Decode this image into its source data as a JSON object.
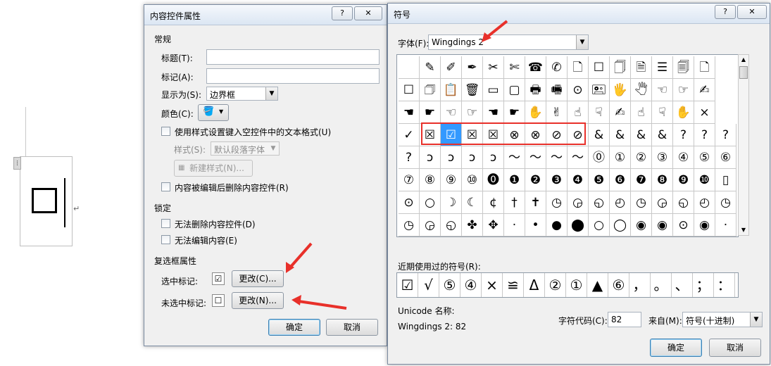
{
  "doc": {
    "return_mark": "↵"
  },
  "content_dialog": {
    "title": "内容控件属性",
    "help_btn": "?",
    "close_btn": "✕",
    "general_section": "常规",
    "title_label": "标题(T):",
    "tag_label": "标记(A):",
    "show_as_label": "显示为(S):",
    "show_as_value": "边界框",
    "color_label": "颜色(C):",
    "use_style_label": "使用样式设置键入空控件中的文本格式(U)",
    "style_label": "样式(S):",
    "style_value": "默认段落字体",
    "new_style_btn": "新建样式(N)...",
    "remove_when_edited": "内容被编辑后删除内容控件(R)",
    "lock_section": "锁定",
    "no_delete": "无法删除内容控件(D)",
    "no_edit": "无法编辑内容(E)",
    "checkbox_section": "复选框属性",
    "checked_label": "选中标记:",
    "checked_symbol": "☑",
    "change_checked_btn": "更改(C)...",
    "unchecked_label": "未选中标记:",
    "unchecked_symbol": "☐",
    "change_unchecked_btn": "更改(N)...",
    "ok": "确定",
    "cancel": "取消"
  },
  "symbol_dialog": {
    "title": "符号",
    "help_btn": "?",
    "close_btn": "✕",
    "font_label": "字体(F):",
    "font_value": "Wingdings 2",
    "grid_rows": [
      [
        "",
        "✎",
        "✐",
        "✒",
        "✂",
        "✄",
        "☎",
        "✆",
        "🗋",
        "☐",
        "🗍",
        "🗎",
        "☰",
        "🗐",
        "🗋"
      ],
      [
        "☐",
        "🗇",
        "📋",
        "🗑",
        "▭",
        "▢",
        "🖶",
        "🖷",
        "⊙",
        "🖭",
        "🖐",
        "🖑",
        "☜",
        "☞",
        "✍"
      ],
      [
        "☚",
        "☛",
        "☜",
        "☞",
        "☚",
        "☛",
        "✋",
        "✌",
        "☝",
        "☟",
        "✍",
        "☝",
        "☟",
        "✋",
        "×"
      ],
      [
        "✓",
        "☒",
        "☑",
        "☒",
        "☒",
        "⊗",
        "⊗",
        "⊘",
        "⊘",
        "&",
        "&",
        "&",
        "&",
        "?",
        "?",
        "?"
      ],
      [
        "?",
        "ↄ",
        "ↄ",
        "ↄ",
        "ↄ",
        "〜",
        "〜",
        "〜",
        "〜",
        "⓪",
        "①",
        "②",
        "③",
        "④",
        "⑤",
        "⑥"
      ],
      [
        "⑦",
        "⑧",
        "⑨",
        "⑩",
        "⓿",
        "❶",
        "❷",
        "❸",
        "❹",
        "❺",
        "❻",
        "❼",
        "❽",
        "❾",
        "❿",
        "▯"
      ],
      [
        "⊙",
        "○",
        "☽",
        "☾",
        "¢",
        "†",
        "✝",
        "◷",
        "◶",
        "◵",
        "◴",
        "◷",
        "◶",
        "◵",
        "◴",
        "◷"
      ],
      [
        "◷",
        "◶",
        "◵",
        "✤",
        "✥",
        "·",
        "•",
        "●",
        "⬤",
        "○",
        "◯",
        "◉",
        "◉",
        "⊙",
        "◉",
        "·"
      ]
    ],
    "recent_label": "近期使用过的符号(R):",
    "recent": [
      "☑",
      "√",
      "⑤",
      "④",
      "×",
      "≌",
      "Δ",
      "②",
      "①",
      "▲",
      "⑥",
      "，",
      "。",
      "、",
      "；",
      "："
    ],
    "unicode_name_label": "Unicode 名称:",
    "unicode_name_value": "Wingdings 2: 82",
    "char_code_label": "字符代码(C):",
    "char_code_value": "82",
    "from_label": "来自(M):",
    "from_value": "符号(十进制)",
    "ok": "确定",
    "cancel": "取消"
  },
  "colors": {
    "arrow": "#e8302a",
    "highlight_box": "#e8302a",
    "selection": "#3399ff"
  }
}
